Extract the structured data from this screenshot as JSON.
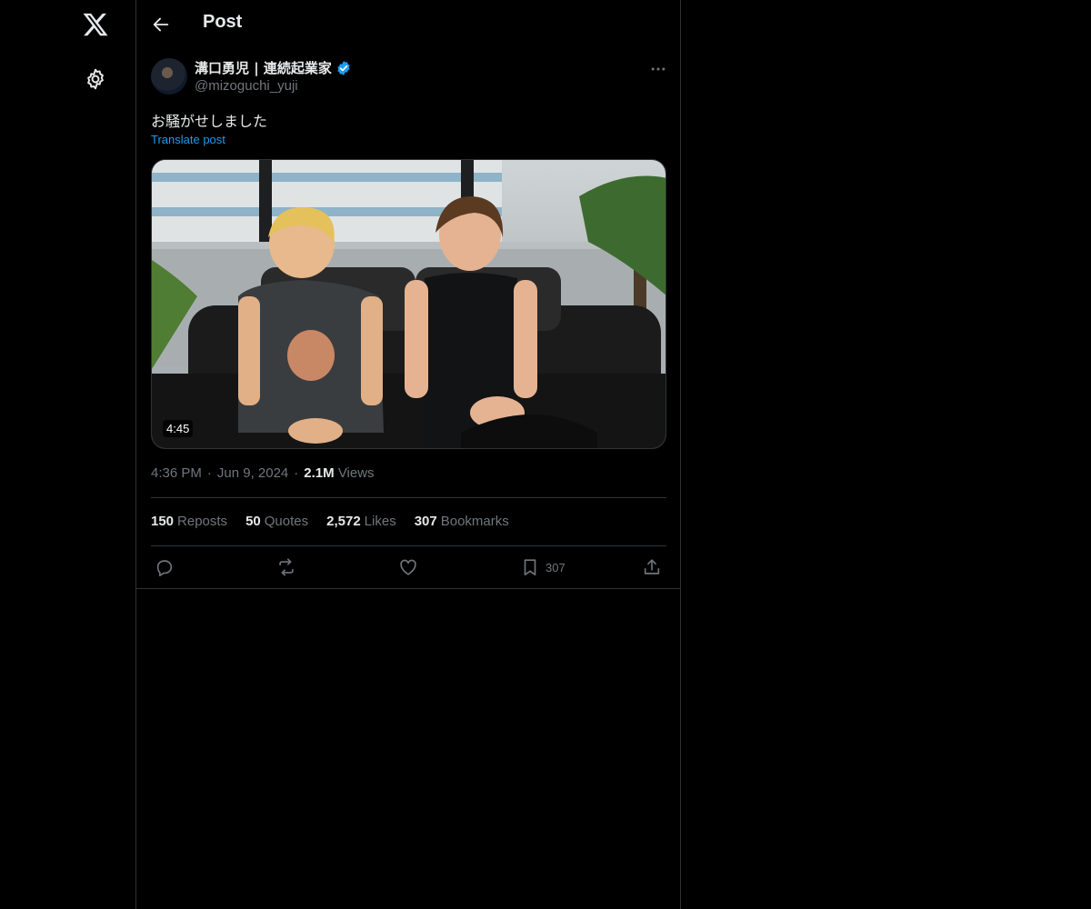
{
  "header": {
    "title": "Post"
  },
  "author": {
    "display_name": "溝口勇児 | 連続起業家",
    "handle": "@mizoguchi_yuji",
    "verified": true
  },
  "tweet": {
    "text": "お騒がせしました",
    "translate_label": "Translate post",
    "video_duration": "4:45"
  },
  "meta": {
    "time": "4:36 PM",
    "separator": "·",
    "date": "Jun 9, 2024",
    "views_count": "2.1M",
    "views_label": "Views"
  },
  "stats": [
    {
      "count": "150",
      "label": "Reposts"
    },
    {
      "count": "50",
      "label": "Quotes"
    },
    {
      "count": "2,572",
      "label": "Likes"
    },
    {
      "count": "307",
      "label": "Bookmarks"
    }
  ],
  "actions": {
    "bookmark_count": "307"
  },
  "icons": {
    "logo": "x-logo-icon",
    "settings": "gear-icon",
    "back": "arrow-left-icon",
    "verified": "verified-badge-icon",
    "more": "more-horizontal-icon",
    "reply": "reply-icon",
    "repost": "repost-icon",
    "like": "heart-icon",
    "bookmark": "bookmark-icon",
    "share": "share-icon"
  },
  "colors": {
    "background": "#000000",
    "text": "#e7e9ea",
    "secondary": "#71767b",
    "accent": "#1d9bf0",
    "border": "#2f3336"
  }
}
